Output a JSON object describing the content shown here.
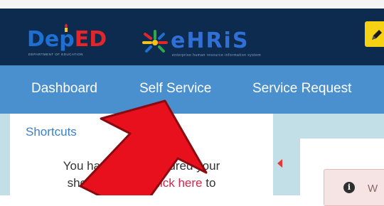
{
  "header": {
    "deped_logo": {
      "d": "D",
      "e": "e",
      "p": "p",
      "ed": "ED",
      "tagline": "DEPARTMENT OF EDUCATION"
    },
    "ehris_logo": {
      "text": "eHRiS",
      "tagline": "enterprise human resource information system"
    },
    "edit_icon": "pencil-icon",
    "accent_color": "#f6d215"
  },
  "nav": {
    "items": [
      {
        "label": "Dashboard"
      },
      {
        "label": "Self Service"
      },
      {
        "label": "Service Request"
      }
    ],
    "background": "#4a90cf"
  },
  "shortcuts": {
    "title": "Shortcuts",
    "line1": "You have not configured your",
    "line2_before": "shortcut icons. ",
    "line2_link": "Click here",
    "line2_after": " to"
  },
  "alert": {
    "icon": "info-icon",
    "icon_glyph": "i",
    "text": "W"
  },
  "annotation": {
    "arrow_color": "#e8101c"
  }
}
